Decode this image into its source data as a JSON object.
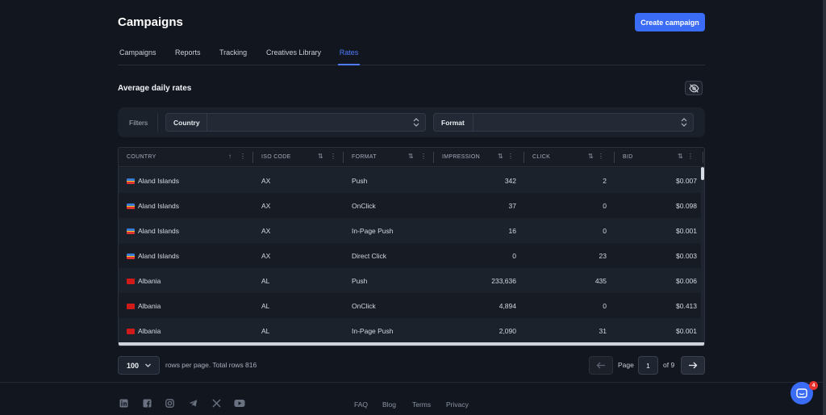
{
  "header": {
    "title": "Campaigns",
    "create_label": "Create campaign"
  },
  "tabs": [
    {
      "label": "Campaigns",
      "active": false
    },
    {
      "label": "Reports",
      "active": false
    },
    {
      "label": "Tracking",
      "active": false
    },
    {
      "label": "Creatives Library",
      "active": false
    },
    {
      "label": "Rates",
      "active": true
    }
  ],
  "section": {
    "title": "Average daily rates"
  },
  "filters": {
    "label": "Filters",
    "country_label": "Country",
    "format_label": "Format"
  },
  "table": {
    "columns": [
      "COUNTRY",
      "ISO CODE",
      "FORMAT",
      "IMPRESSION",
      "CLICK",
      "BID"
    ],
    "rows": [
      {
        "country": "Aland Islands",
        "iso": "AX",
        "format": "Push",
        "impression": "342",
        "click": "2",
        "bid": "$0.007"
      },
      {
        "country": "Aland Islands",
        "iso": "AX",
        "format": "OnClick",
        "impression": "37",
        "click": "0",
        "bid": "$0.098"
      },
      {
        "country": "Aland Islands",
        "iso": "AX",
        "format": "In-Page Push",
        "impression": "16",
        "click": "0",
        "bid": "$0.001"
      },
      {
        "country": "Aland Islands",
        "iso": "AX",
        "format": "Direct Click",
        "impression": "0",
        "click": "23",
        "bid": "$0.003"
      },
      {
        "country": "Albania",
        "iso": "AL",
        "format": "Push",
        "impression": "233,636",
        "click": "435",
        "bid": "$0.006"
      },
      {
        "country": "Albania",
        "iso": "AL",
        "format": "OnClick",
        "impression": "4,894",
        "click": "0",
        "bid": "$0.413"
      },
      {
        "country": "Albania",
        "iso": "AL",
        "format": "In-Page Push",
        "impression": "2,090",
        "click": "31",
        "bid": "$0.001"
      }
    ]
  },
  "pagination": {
    "rows_per_page": "100",
    "rows_text": "rows per page. Total rows 816",
    "page_label": "Page",
    "current_page": "1",
    "of_text": "of 9"
  },
  "footer": {
    "social": [
      "linkedin-icon",
      "facebook-icon",
      "instagram-icon",
      "telegram-icon",
      "x-icon",
      "youtube-icon"
    ],
    "links": [
      "FAQ",
      "Blog",
      "Terms",
      "Privacy"
    ]
  },
  "chat": {
    "badge": "4"
  },
  "colors": {
    "accent": "#3b6cf6",
    "background": "#12161f",
    "badge": "#e5322d"
  }
}
